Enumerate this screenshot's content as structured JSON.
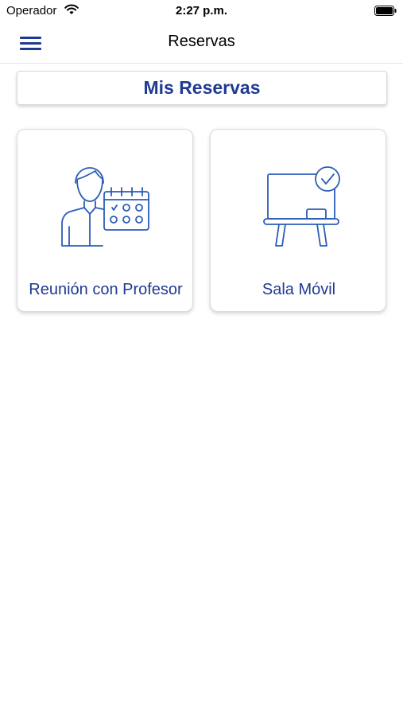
{
  "status_bar": {
    "carrier": "Operador",
    "time": "2:27 p.m."
  },
  "nav": {
    "title": "Reservas",
    "menu_icon": "hamburger-menu-icon"
  },
  "mis_reservas": {
    "label": "Mis Reservas"
  },
  "cards": [
    {
      "label": "Reunión con Profesor",
      "icon": "teacher-calendar-icon"
    },
    {
      "label": "Sala Móvil",
      "icon": "whiteboard-check-icon"
    }
  ],
  "colors": {
    "accent": "#1f3a93",
    "icon_blue": "#2b5cb8"
  }
}
